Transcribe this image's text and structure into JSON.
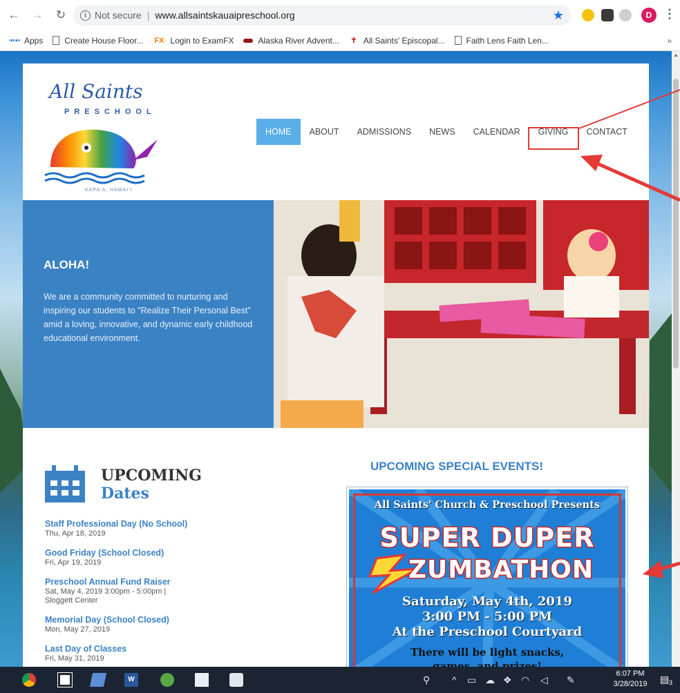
{
  "browser": {
    "url_status": "Not secure",
    "url": "www.allsaintskauaipreschool.org",
    "bookmarks": [
      {
        "label": "Apps",
        "icon": "apps-grid-icon"
      },
      {
        "label": "Create House Floor...",
        "icon": "page-icon"
      },
      {
        "label": "Login to ExamFX",
        "icon": "fx-icon"
      },
      {
        "label": "Alaska River Advent...",
        "icon": "boat-icon"
      },
      {
        "label": "All Saints' Episcopal...",
        "icon": "cross-icon"
      },
      {
        "label": "Faith Lens Faith Len...",
        "icon": "page-icon"
      }
    ],
    "profile_initial": "D",
    "more": "»"
  },
  "site": {
    "logo": {
      "script": "All Saints",
      "sub": "PRESCHOOL",
      "place": "KAPA'A, HAWAI'I"
    },
    "nav": [
      "HOME",
      "ABOUT",
      "ADMISSIONS",
      "NEWS",
      "CALENDAR",
      "GIVING",
      "CONTACT"
    ],
    "hero": {
      "heading": "ALOHA!",
      "text": "We are a community committed to nurturing and inspiring our students to \"Realize Their Personal Best\" amid a loving, innovative, and dynamic early childhood educational environment."
    },
    "upcoming": {
      "title": "UPCOMING",
      "subtitle": "Dates",
      "events": [
        {
          "title": "Staff Professional Day (No School)",
          "date": "Thu, Apr 18, 2019"
        },
        {
          "title": "Good Friday (School Closed)",
          "date": "Fri, Apr 19, 2019"
        },
        {
          "title": "Preschool Annual Fund Raiser",
          "date": "Sat, May 4, 2019 3:00pm - 5:00pm | Sloggett Center"
        },
        {
          "title": "Memorial Day (School Closed)",
          "date": "Mon, May 27, 2019"
        },
        {
          "title": "Last Day of Classes",
          "date": "Fri, May 31, 2019"
        }
      ]
    },
    "special": {
      "title": "UPCOMING SPECIAL EVENTS!",
      "flyer": {
        "header": "All Saints' Church & Preschool Presents",
        "line1": "SUPER DUPER",
        "line2": "ZUMBATHON",
        "date_line": "Saturday, May 4th, 2019",
        "time_line": "3:00 PM - 5:00 PM",
        "place_line": "At the Preschool Courtyard",
        "snacks_line": "There will be light snacks,",
        "games_line": "games, and prizes!"
      }
    }
  },
  "taskbar": {
    "time": "6:07 PM",
    "date": "3/28/2019",
    "notifications": "3"
  },
  "colors": {
    "brand_blue": "#3b82c4",
    "nav_active": "#5aafea",
    "annotation_red": "#e53935"
  }
}
